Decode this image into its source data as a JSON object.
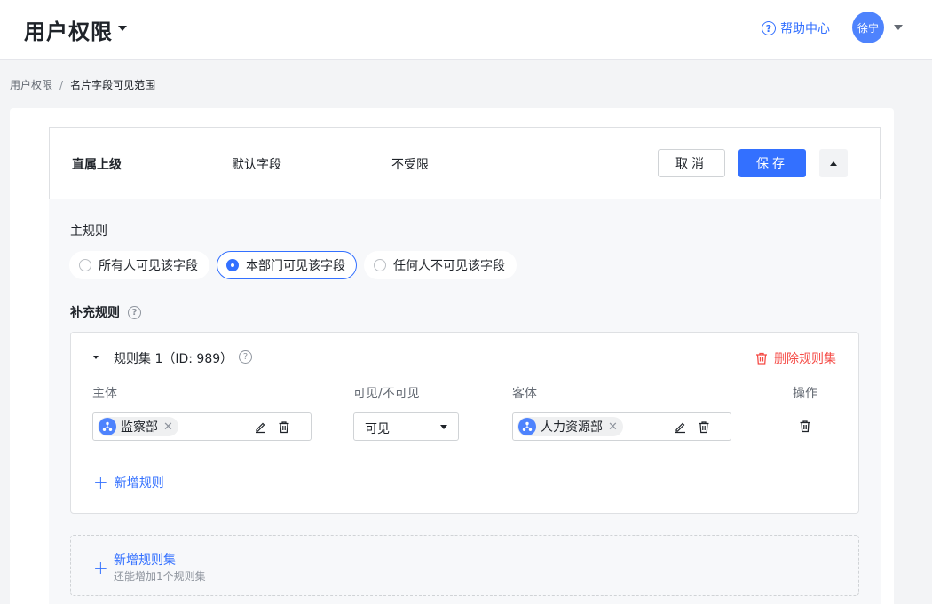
{
  "header": {
    "app_title": "用户权限",
    "help_label": "帮助中心",
    "help_icon": "question-circle-icon",
    "user_name": "徐宁"
  },
  "breadcrumb": {
    "parent": "用户权限",
    "separator": "/",
    "current": "名片字段可见范围"
  },
  "field_row": {
    "name": "直属上级",
    "type": "默认字段",
    "scope": "不受限",
    "cancel_label": "取消",
    "save_label": "保存"
  },
  "main_rule": {
    "label": "主规则",
    "options": [
      "所有人可见该字段",
      "本部门可见该字段",
      "任何人不可见该字段"
    ],
    "selected": "本部门可见该字段"
  },
  "supplement": {
    "label": "补充规则",
    "rulesets": [
      {
        "title": "规则集 1（ID: 989）",
        "delete_label": "删除规则集",
        "columns": {
          "subject": "主体",
          "visibility": "可见/不可见",
          "object": "客体",
          "action": "操作"
        },
        "rules": [
          {
            "subject": "监察部",
            "visibility": "可见",
            "object": "人力资源部"
          }
        ],
        "add_rule_label": "新增规则"
      }
    ],
    "add_ruleset_label": "新增规则集",
    "add_ruleset_hint": "还能增加1个规则集"
  },
  "colors": {
    "primary": "#3370ff",
    "danger": "#f54a45",
    "avatar": "#4e83fd"
  }
}
